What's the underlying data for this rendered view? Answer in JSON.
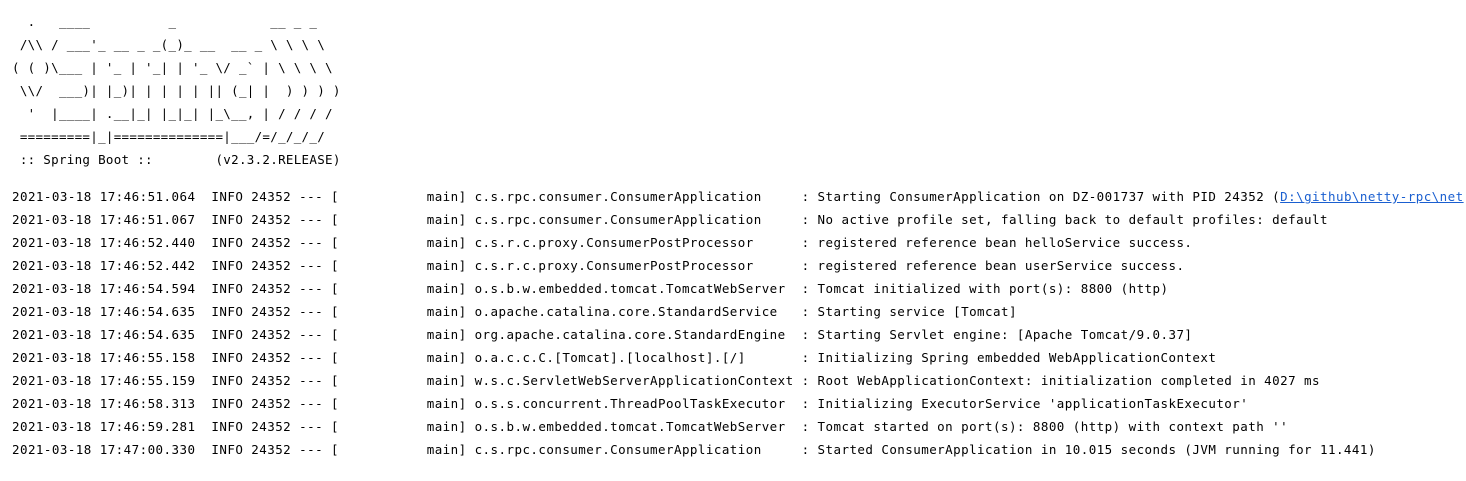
{
  "banner": {
    "ascii_art": "  .   ____          _            __ _ _\n /\\\\ / ___'_ __ _ _(_)_ __  __ _ \\ \\ \\ \\\n( ( )\\___ | '_ | '_| | '_ \\/ _` | \\ \\ \\ \\\n \\\\/  ___)| |_)| | | | | || (_| |  ) ) ) )\n  '  |____| .__|_| |_|_| |_\\__, | / / / /\n =========|_|==============|___/=/_/_/_/",
    "version_line": " :: Spring Boot ::        (v2.3.2.RELEASE)"
  },
  "log": {
    "lines": [
      {
        "text": "2021-03-18 17:46:51.064  INFO 24352 --- [           main] c.s.rpc.consumer.ConsumerApplication     : Starting ConsumerApplication on DZ-001737 with PID 24352 (",
        "link": "D:\\github\\netty-rpc\\net"
      },
      {
        "text": "2021-03-18 17:46:51.067  INFO 24352 --- [           main] c.s.rpc.consumer.ConsumerApplication     : No active profile set, falling back to default profiles: default"
      },
      {
        "text": "2021-03-18 17:46:52.440  INFO 24352 --- [           main] c.s.r.c.proxy.ConsumerPostProcessor      : registered reference bean helloService success."
      },
      {
        "text": "2021-03-18 17:46:52.442  INFO 24352 --- [           main] c.s.r.c.proxy.ConsumerPostProcessor      : registered reference bean userService success."
      },
      {
        "text": "2021-03-18 17:46:54.594  INFO 24352 --- [           main] o.s.b.w.embedded.tomcat.TomcatWebServer  : Tomcat initialized with port(s): 8800 (http)"
      },
      {
        "text": "2021-03-18 17:46:54.635  INFO 24352 --- [           main] o.apache.catalina.core.StandardService   : Starting service [Tomcat]"
      },
      {
        "text": "2021-03-18 17:46:54.635  INFO 24352 --- [           main] org.apache.catalina.core.StandardEngine  : Starting Servlet engine: [Apache Tomcat/9.0.37]"
      },
      {
        "text": "2021-03-18 17:46:55.158  INFO 24352 --- [           main] o.a.c.c.C.[Tomcat].[localhost].[/]       : Initializing Spring embedded WebApplicationContext"
      },
      {
        "text": "2021-03-18 17:46:55.159  INFO 24352 --- [           main] w.s.c.ServletWebServerApplicationContext : Root WebApplicationContext: initialization completed in 4027 ms"
      },
      {
        "text": "2021-03-18 17:46:58.313  INFO 24352 --- [           main] o.s.s.concurrent.ThreadPoolTaskExecutor  : Initializing ExecutorService 'applicationTaskExecutor'"
      },
      {
        "text": "2021-03-18 17:46:59.281  INFO 24352 --- [           main] o.s.b.w.embedded.tomcat.TomcatWebServer  : Tomcat started on port(s): 8800 (http) with context path ''"
      },
      {
        "text": "2021-03-18 17:47:00.330  INFO 24352 --- [           main] c.s.rpc.consumer.ConsumerApplication     : Started ConsumerApplication in 10.015 seconds (JVM running for 11.441)"
      }
    ]
  },
  "colors": {
    "background": "#ffffff",
    "text": "#000000",
    "link": "#1a5fd0"
  }
}
